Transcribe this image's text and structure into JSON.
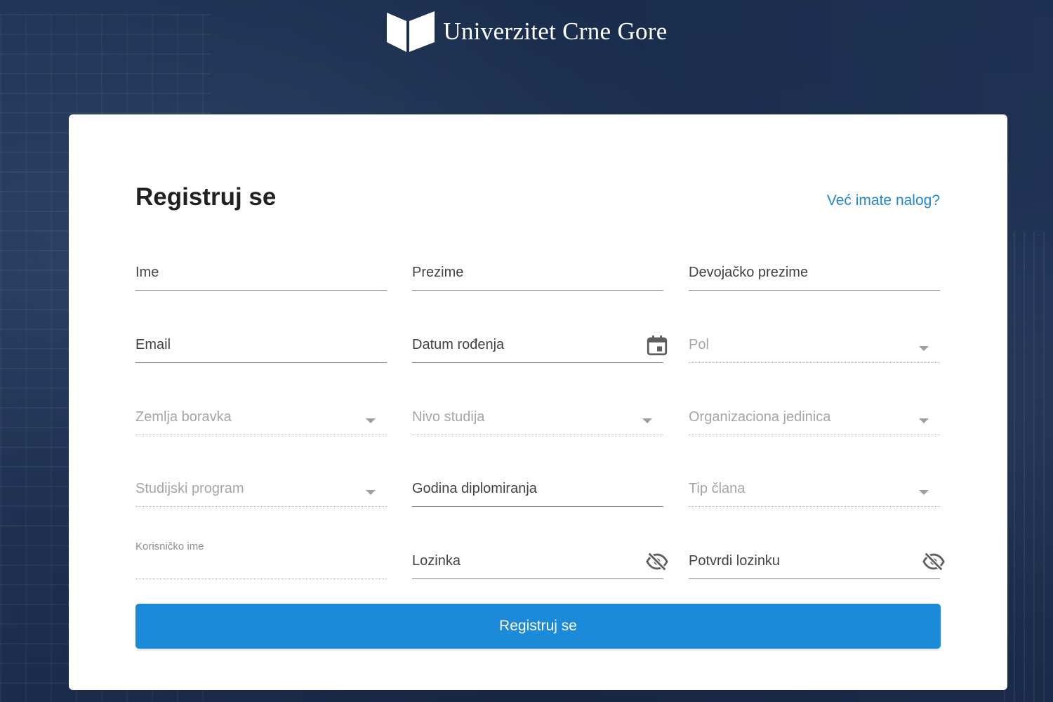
{
  "header": {
    "brand": "Univerzitet Crne Gore",
    "logo_icon": "open-book-logo-icon"
  },
  "form": {
    "title": "Registruj se",
    "login_link": "Već imate nalog?",
    "fields": {
      "ime": "Ime",
      "prezime": "Prezime",
      "devojacko": "Devojačko prezime",
      "email": "Email",
      "datum": "Datum rođenja",
      "pol": "Pol",
      "zemlja": "Zemlja boravka",
      "nivo": "Nivo studija",
      "org": "Organizaciona jedinica",
      "program": "Studijski program",
      "godina": "Godina diplomiranja",
      "tip": "Tip člana",
      "korisnicko": "Korisničko ime",
      "lozinka": "Lozinka",
      "potvrdi": "Potvrdi lozinku"
    },
    "submit_label": "Registruj se"
  },
  "colors": {
    "accent": "#1b8ad9",
    "link": "#1f87d6",
    "background": "#1e3253"
  },
  "icons": [
    "calendar-icon",
    "eye-off-icon",
    "chevron-down-icon"
  ]
}
